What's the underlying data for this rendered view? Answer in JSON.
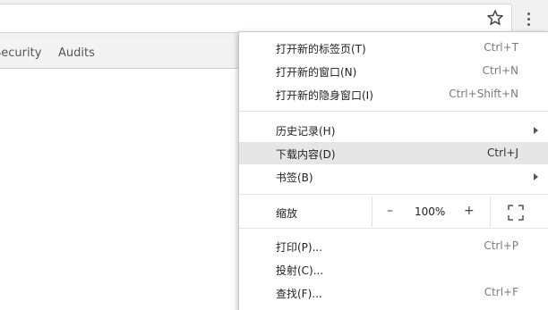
{
  "devtools_tabs": [
    "Security",
    "Audits"
  ],
  "toolbar": {
    "bookmark_icon": "star-icon",
    "menu_icon": "kebab-icon"
  },
  "menu": {
    "items": [
      {
        "label": "打开新的标签页(T)",
        "shortcut": "Ctrl+T"
      },
      {
        "label": "打开新的窗口(N)",
        "shortcut": "Ctrl+N"
      },
      {
        "label": "打开新的隐身窗口(I)",
        "shortcut": "Ctrl+Shift+N"
      },
      {
        "label": "历史记录(H)",
        "submenu": true
      },
      {
        "label": "下载内容(D)",
        "shortcut": "Ctrl+J",
        "highlighted": true
      },
      {
        "label": "书签(B)",
        "submenu": true
      },
      {
        "label": "打印(P)...",
        "shortcut": "Ctrl+P"
      },
      {
        "label": "投射(C)...",
        "shortcut": ""
      },
      {
        "label": "查找(F)...",
        "shortcut": "Ctrl+F"
      }
    ],
    "zoom": {
      "label": "缩放",
      "minus": "–",
      "level": "100%",
      "plus": "+",
      "fullscreen_icon": "fullscreen-icon"
    }
  },
  "colors": {
    "toolbar_bg": "#f1f1f1",
    "highlight_bg": "#e6e6e6",
    "shortcut_text": "#7b7b7b"
  }
}
